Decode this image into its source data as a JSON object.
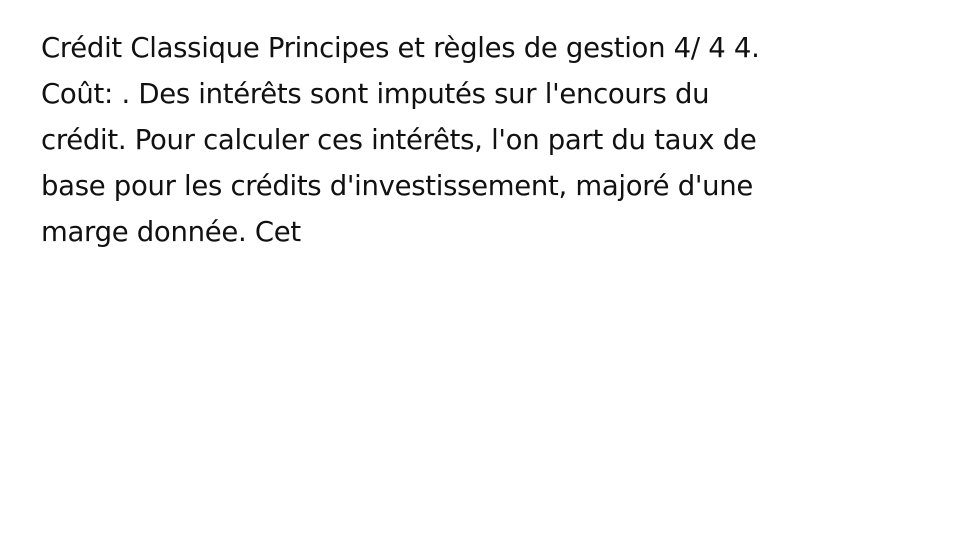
{
  "document": {
    "lines": [
      "Crédit Classique Principes et règles de gestion 4/ 4 4.",
      "Coût: . Des intérêts sont imputés sur l'encours du",
      "crédit. Pour calculer ces intérêts, l'on part du taux de",
      "base pour les crédits d'investissement, majoré d'une",
      "marge donnée. Cet"
    ]
  },
  "colors": {
    "background": "#ffffff",
    "text": "#111111"
  }
}
